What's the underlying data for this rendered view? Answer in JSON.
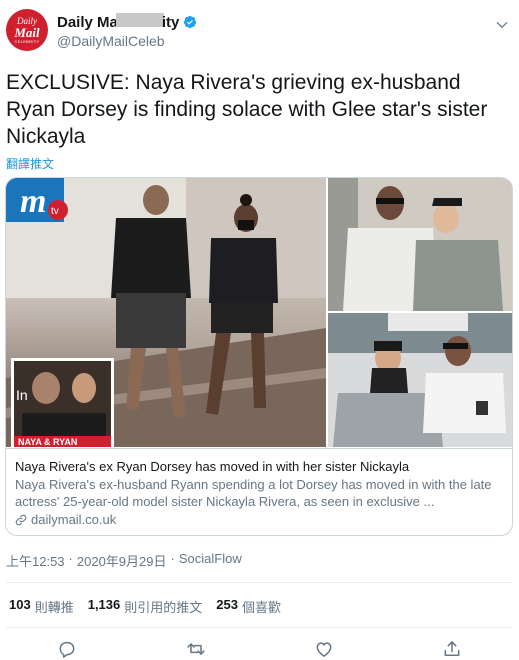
{
  "tweet": {
    "author": {
      "name": "Daily Ma",
      "name_tail": "ity",
      "handle": "@DailyMailCeleb",
      "avatar_lines": [
        "Daily",
        "Mail",
        "CELEBRITY"
      ]
    },
    "text": "EXCLUSIVE: Naya Rivera's grieving ex-husband Ryan Dorsey is finding solace with Glee star's sister Nickayla",
    "translate_label": "翻譯推文",
    "card": {
      "title": "Naya Rivera's ex Ryan Dorsey has moved in with her sister Nickayla",
      "description": "Naya Rivera's ex-husband Ryann spending a lot Dorsey has moved in with the late actress' 25-year-old model sister Nickayla Rivera, as seen in exclusive ...",
      "domain": "dailymail.co.uk",
      "photo_badge": "m",
      "photo_tv": "tv",
      "inset_text": "NAYA & RYAN",
      "inset_partial": "In"
    },
    "meta": {
      "time": "上午12:53",
      "separator": "·",
      "date": "2020年9月29日",
      "source": "SocialFlow"
    },
    "stats": {
      "retweets": {
        "num": "103",
        "label": "則轉推"
      },
      "quotes": {
        "num": "1,136",
        "label": "則引用的推文"
      },
      "likes": {
        "num": "253",
        "label": "個喜歡"
      }
    },
    "icons": {
      "verified": "verified-badge-icon",
      "more": "chevron-down-icon",
      "link": "link-icon",
      "reply": "reply-icon",
      "retweet": "retweet-icon",
      "like": "heart-icon",
      "share": "share-icon"
    },
    "colors": {
      "accent": "#1da1f2",
      "link": "#1b95e0",
      "muted": "#657786",
      "brand_red": "#d0202f"
    }
  }
}
